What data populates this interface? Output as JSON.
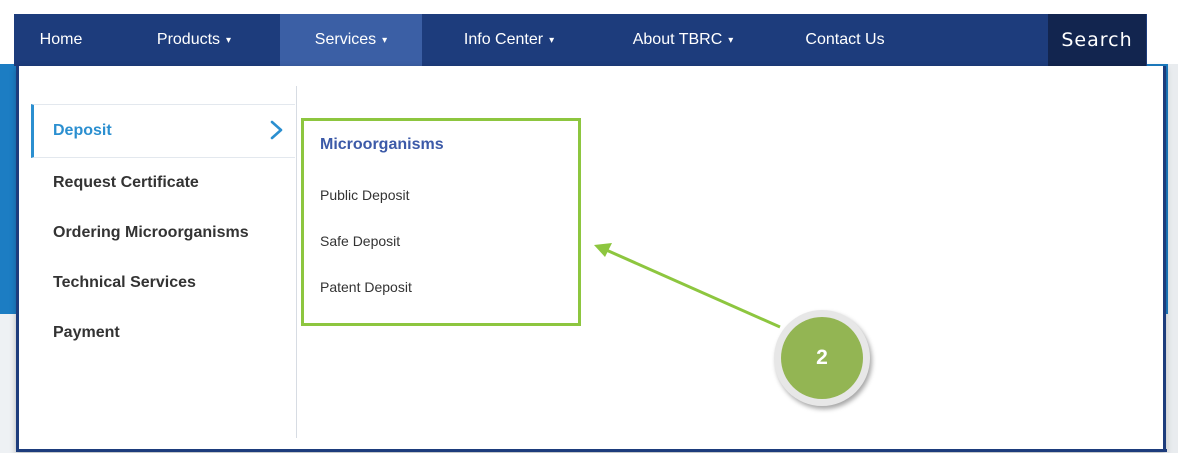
{
  "nav": {
    "items": [
      {
        "label": "Home",
        "has_caret": false,
        "active": false
      },
      {
        "label": "Products",
        "has_caret": true,
        "active": false
      },
      {
        "label": "Services",
        "has_caret": true,
        "active": true
      },
      {
        "label": "Info Center",
        "has_caret": true,
        "active": false
      },
      {
        "label": "About TBRC",
        "has_caret": true,
        "active": false
      },
      {
        "label": "Contact Us",
        "has_caret": false,
        "active": false
      }
    ],
    "caret": "▾",
    "search_label": "Search"
  },
  "services_menu": {
    "items": [
      {
        "label": "Deposit",
        "active": true
      },
      {
        "label": "Request Certificate",
        "active": false
      },
      {
        "label": "Ordering Microorganisms",
        "active": false
      },
      {
        "label": "Technical Services",
        "active": false
      },
      {
        "label": "Payment",
        "active": false
      }
    ],
    "active_indicator_icon": "chevron-right-icon"
  },
  "deposit_panel": {
    "heading": "Microorganisms",
    "links": [
      "Public Deposit",
      "Safe Deposit",
      "Patent Deposit"
    ]
  },
  "annotation": {
    "step_number": "2",
    "color": "#8dc63f"
  },
  "colors": {
    "nav_bg": "#1d3c7c",
    "nav_active": "#3b5fa5",
    "search_bg": "#12254f",
    "accent": "#2b8fd0",
    "heading": "#3c5aa8"
  }
}
